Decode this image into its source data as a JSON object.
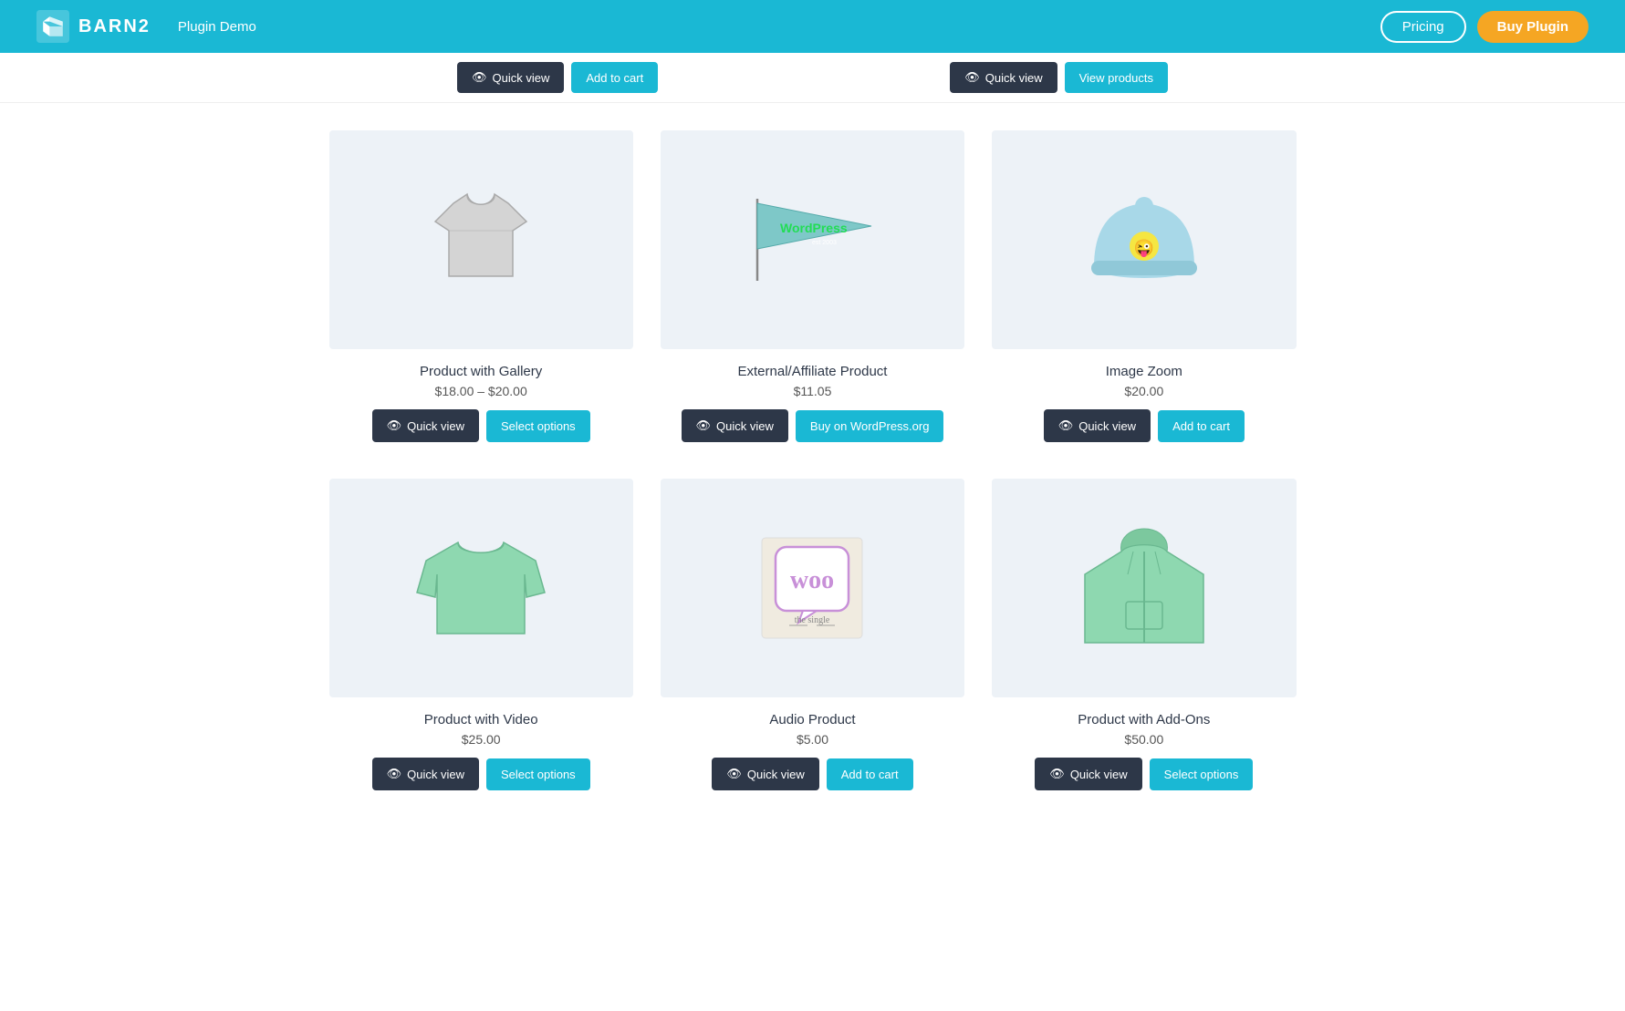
{
  "header": {
    "brand": "BARN2",
    "nav_label": "Plugin Demo",
    "pricing_label": "Pricing",
    "buy_label": "Buy Plugin"
  },
  "top_strip": {
    "left": {
      "quickview_label": "Quick view",
      "addcart_label": "Add to cart"
    },
    "right": {
      "quickview_label": "Quick view",
      "viewproducts_label": "View products"
    }
  },
  "products_row1": [
    {
      "name": "Product with Gallery",
      "price": "$18.00 – $20.00",
      "quickview": "Quick view",
      "action": "Select options",
      "action_type": "select"
    },
    {
      "name": "External/Affiliate Product",
      "price": "$11.05",
      "quickview": "Quick view",
      "action": "Buy on WordPress.org",
      "action_type": "external"
    },
    {
      "name": "Image Zoom",
      "price": "$20.00",
      "quickview": "Quick view",
      "action": "Add to cart",
      "action_type": "cart"
    }
  ],
  "products_row2": [
    {
      "name": "Product with Video",
      "price": "$25.00",
      "quickview": "Quick view",
      "action": "Select options",
      "action_type": "select"
    },
    {
      "name": "Audio Product",
      "price": "$5.00",
      "quickview": "Quick view",
      "action": "Add to cart",
      "action_type": "cart"
    },
    {
      "name": "Product with Add-Ons",
      "price": "$50.00",
      "quickview": "Quick view",
      "action": "Select options",
      "action_type": "select"
    }
  ]
}
